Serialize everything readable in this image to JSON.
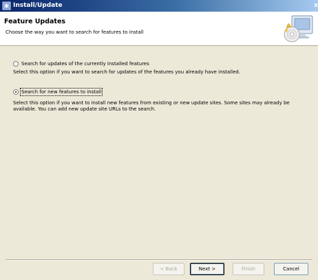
{
  "window": {
    "title": "Install/Update",
    "close_label": "x"
  },
  "header": {
    "title": "Feature Updates",
    "subtitle": "Choose the way you want to search for features to install"
  },
  "options": [
    {
      "label": "Search for updates of the currently installed features",
      "selected": false,
      "description": "Select this option if you want to search for updates of the features you already have installed."
    },
    {
      "label": "Search for new features to install",
      "selected": true,
      "description": "Select this option if you want to install new features from existing or new update sites. Some sites may already be available. You can add new update site URLs to the search."
    }
  ],
  "buttons": {
    "back": "< Back",
    "next": "Next >",
    "finish": "Finish",
    "cancel": "Cancel"
  },
  "icons": {
    "app": "install-update-icon",
    "wizard": "monitor-cd-icon"
  },
  "colors": {
    "titlebar": "#0a246a",
    "dialog_bg": "#ece9d8",
    "banner_bg": "#ffffff"
  }
}
